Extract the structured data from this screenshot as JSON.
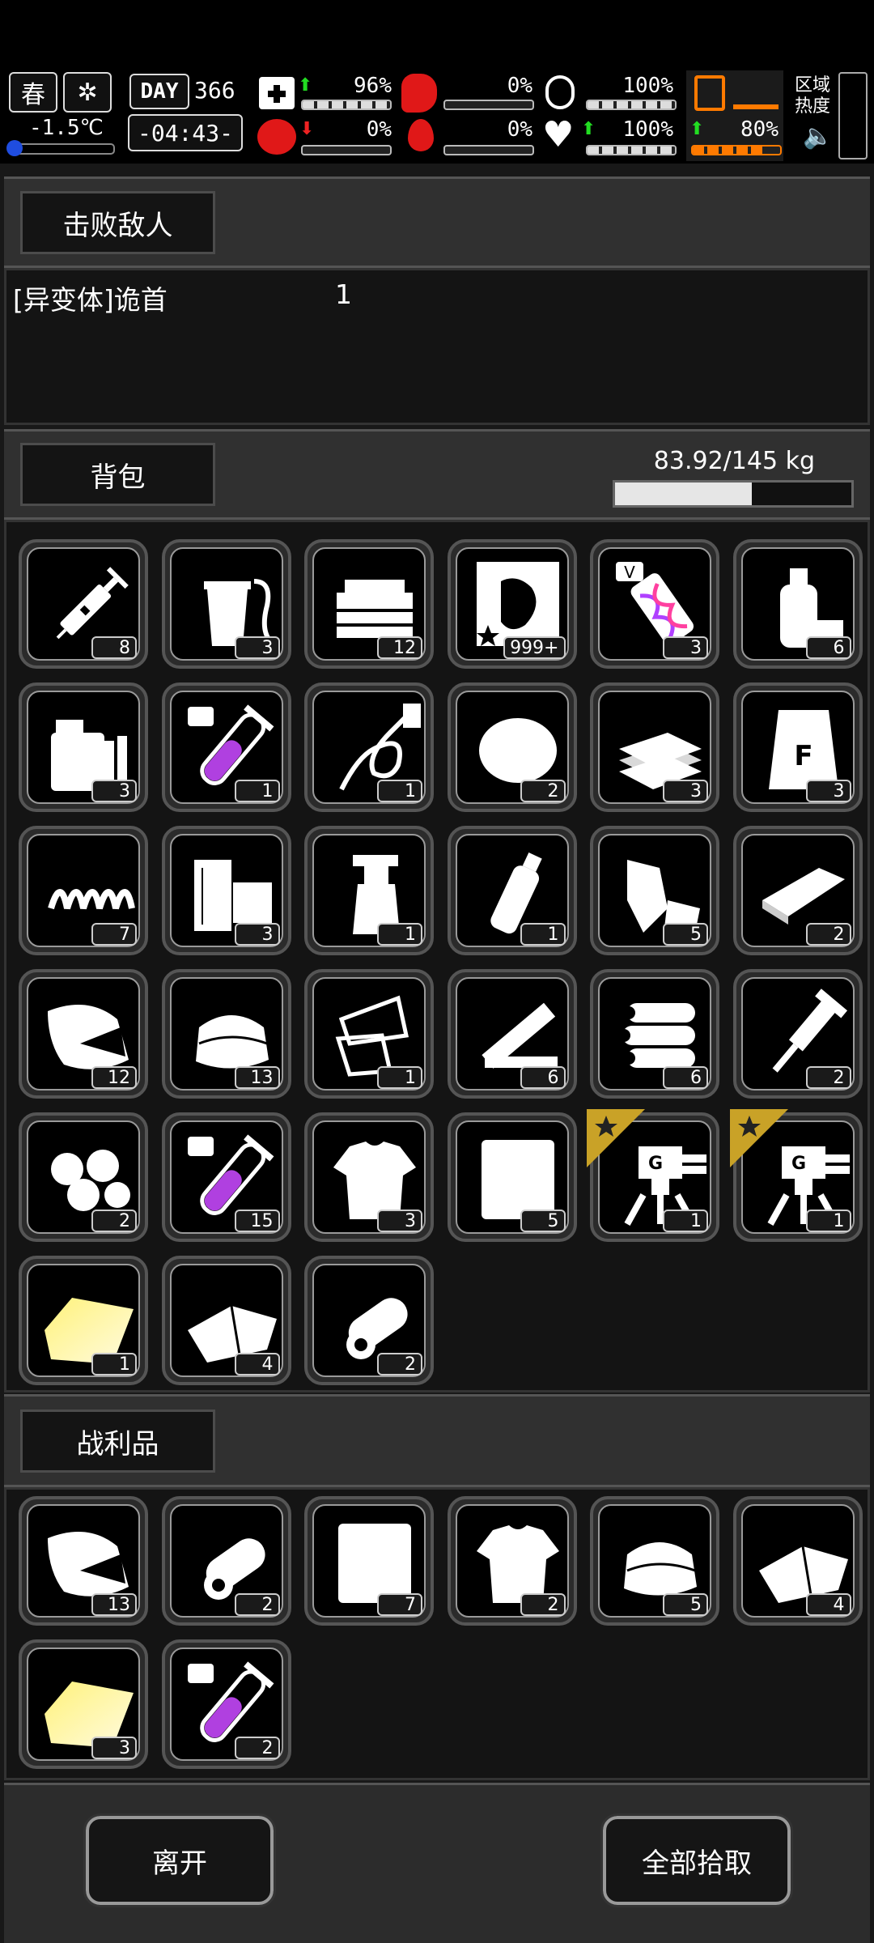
{
  "hud": {
    "season": "春",
    "temperature": "-1.5℃",
    "day_label": "DAY",
    "day": "366",
    "time": "-04:43-",
    "area_heat": "区域\n热度",
    "stats": [
      {
        "name": "health",
        "value": "96%",
        "fill": 0.96,
        "arrow": "up"
      },
      {
        "name": "hunger",
        "value": "0%",
        "fill": 0.0,
        "arrow": ""
      },
      {
        "name": "stamina",
        "value": "100%",
        "fill": 1.0,
        "arrow": ""
      },
      {
        "name": "stamina-alt",
        "value": "80%",
        "fill": 0.8,
        "arrow": "up"
      },
      {
        "name": "mind",
        "value": "0%",
        "fill": 0.0,
        "arrow": "down"
      },
      {
        "name": "thirst",
        "value": "0%",
        "fill": 0.0,
        "arrow": ""
      },
      {
        "name": "mood",
        "value": "100%",
        "fill": 1.0,
        "arrow": "up"
      }
    ],
    "colors": {
      "up": "#22dd22",
      "down": "#ee2222",
      "orange": "#ff7a00",
      "red": "#e01818"
    }
  },
  "defeated": {
    "tab": "击败敌人",
    "enemy_name": "[异变体]诡首",
    "enemy_count": "1"
  },
  "backpack": {
    "tab": "背包",
    "weight": "83.92/145 kg",
    "weight_fill": 0.579,
    "items": [
      {
        "icon": "syringe-icon",
        "count": "8"
      },
      {
        "icon": "drink-cup-icon",
        "count": "3"
      },
      {
        "icon": "toolbox-icon",
        "count": "12"
      },
      {
        "icon": "bounty-poster-icon",
        "count": "999+"
      },
      {
        "icon": "dna-vial-icon",
        "count": "3"
      },
      {
        "icon": "spray-canister-icon",
        "count": "6"
      },
      {
        "icon": "jerry-can-icon",
        "count": "3"
      },
      {
        "icon": "purple-test-tube-icon",
        "count": "1"
      },
      {
        "icon": "rope-whip-icon",
        "count": "1"
      },
      {
        "icon": "fur-ball-icon",
        "count": "2"
      },
      {
        "icon": "cloth-stack-icon",
        "count": "3"
      },
      {
        "icon": "flour-sack-icon",
        "count": "3"
      },
      {
        "icon": "spring-coil-icon",
        "count": "7"
      },
      {
        "icon": "wood-blocks-icon",
        "count": "3"
      },
      {
        "icon": "spray-bottle-icon",
        "count": "1"
      },
      {
        "icon": "plastic-bottle-icon",
        "count": "1"
      },
      {
        "icon": "leather-scraps-icon",
        "count": "5"
      },
      {
        "icon": "metal-plate-icon",
        "count": "2"
      },
      {
        "icon": "meat-chunk-icon",
        "count": "12"
      },
      {
        "icon": "folded-cloth-icon",
        "count": "13"
      },
      {
        "icon": "paper-scraps-icon",
        "count": "1"
      },
      {
        "icon": "wooden-planks-icon",
        "count": "6"
      },
      {
        "icon": "logs-icon",
        "count": "6"
      },
      {
        "icon": "grinder-tool-icon",
        "count": "2"
      },
      {
        "icon": "cotton-balls-icon",
        "count": "2"
      },
      {
        "icon": "purple-test-tube-icon",
        "count": "15"
      },
      {
        "icon": "ragged-shirt-icon",
        "count": "3"
      },
      {
        "icon": "white-sheet-icon",
        "count": "5"
      },
      {
        "icon": "turret-icon",
        "count": "1",
        "starred": true
      },
      {
        "icon": "turret-icon",
        "count": "1",
        "starred": true
      },
      {
        "icon": "yellow-cloth-icon",
        "count": "1"
      },
      {
        "icon": "bandage-cloth-icon",
        "count": "4"
      },
      {
        "icon": "cloth-roll-icon",
        "count": "2"
      }
    ]
  },
  "loot": {
    "tab": "战利品",
    "items": [
      {
        "icon": "meat-chunk-icon",
        "count": "13"
      },
      {
        "icon": "cloth-roll-icon",
        "count": "2"
      },
      {
        "icon": "white-sheet-icon",
        "count": "7"
      },
      {
        "icon": "ragged-shirt-icon",
        "count": "2"
      },
      {
        "icon": "folded-cloth-icon",
        "count": "5"
      },
      {
        "icon": "bandage-cloth-icon",
        "count": "4"
      },
      {
        "icon": "yellow-cloth-icon",
        "count": "3"
      },
      {
        "icon": "purple-test-tube-icon",
        "count": "2"
      }
    ]
  },
  "actions": {
    "leave": "离开",
    "take_all": "全部拾取"
  }
}
